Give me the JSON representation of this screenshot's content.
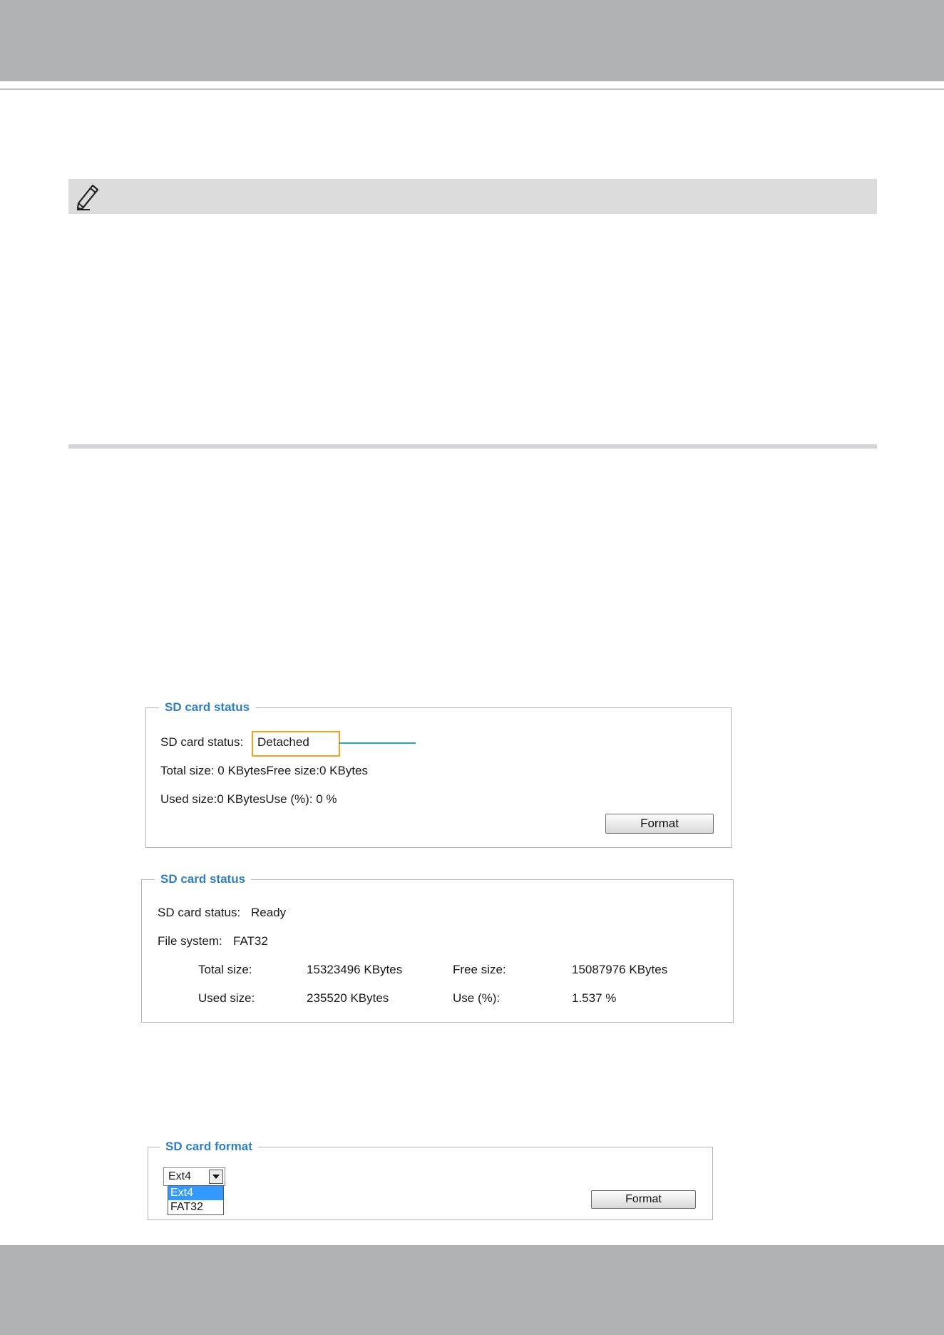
{
  "panel_status_detached": {
    "legend": "SD card status",
    "status_label": "SD card status:",
    "status_value": "Detached",
    "size_line": "Total size: 0  KBytesFree size:0  KBytes",
    "used_line": "Used size:0  KBytesUse (%):  0 %",
    "format_button": "Format"
  },
  "panel_status_ready": {
    "legend": "SD card status",
    "status_label": "SD card status:",
    "status_value": "Ready",
    "filesystem_label": "File system:",
    "filesystem_value": "FAT32",
    "total_label": "Total size:",
    "total_value": "15323496  KBytes",
    "free_label": "Free size:",
    "free_value": "15087976  KBytes",
    "used_label": "Used size:",
    "used_value": "235520  KBytes",
    "use_pct_label": "Use (%):",
    "use_pct_value": "1.537 %"
  },
  "panel_format": {
    "legend": "SD card format",
    "selected_value": "Ext4",
    "options": [
      "Ext4",
      "FAT32"
    ],
    "format_button": "Format"
  },
  "colors": {
    "legend_blue": "#2f7fc6",
    "highlight_orange": "#f3a21b",
    "callout_cyan": "#2aa6c7",
    "selected_option_blue": "#3399ff",
    "band_gray": "#b1b2b4"
  },
  "icons": {
    "note": "pencil-icon",
    "select_arrow": "chevron-down-icon"
  }
}
